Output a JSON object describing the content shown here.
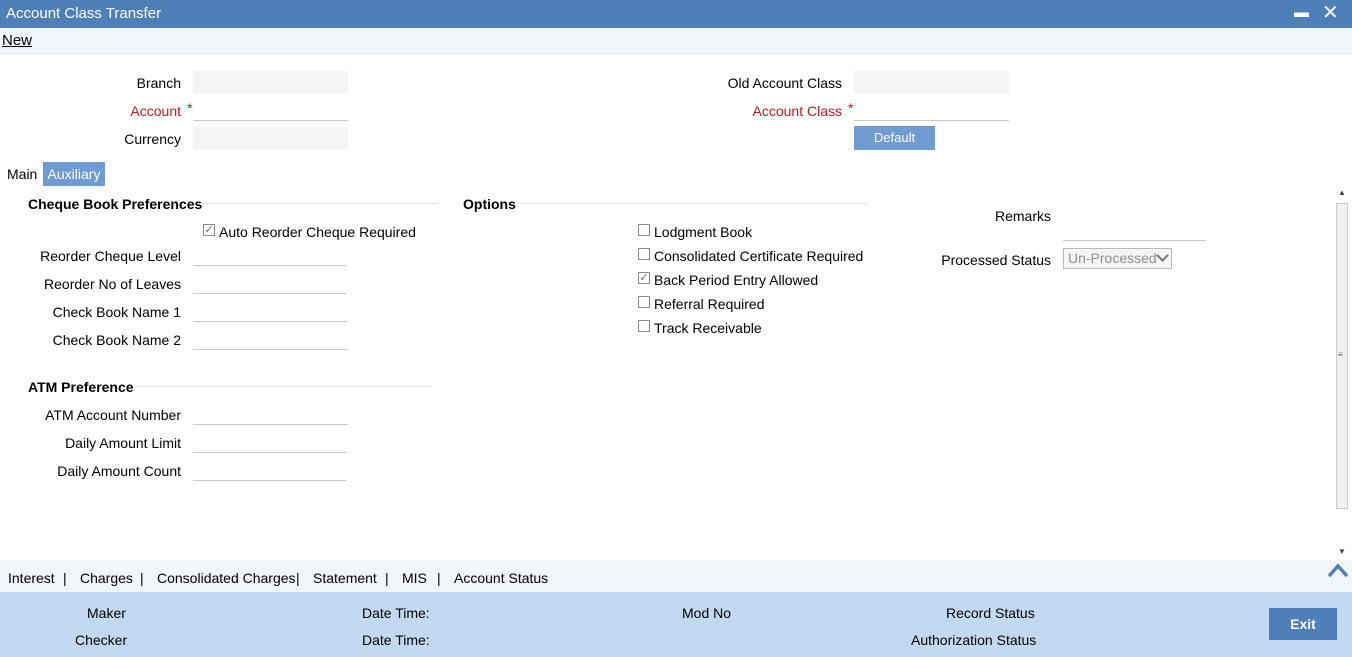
{
  "window": {
    "title": "Account Class Transfer",
    "minimize_glyph": "▬",
    "close_glyph": "✕"
  },
  "menu": {
    "new_label": "New"
  },
  "header": {
    "branch_label": "Branch",
    "account_label": "Account",
    "currency_label": "Currency",
    "old_account_class_label": "Old Account Class",
    "account_class_label": "Account Class",
    "required_mark": "*",
    "default_button": "Default"
  },
  "tabs": {
    "main": "Main",
    "auxiliary": "Auxiliary"
  },
  "cheque_book": {
    "title": "Cheque Book Preferences",
    "auto_reorder_label": "Auto Reorder Cheque Required",
    "auto_reorder_checked": true,
    "reorder_level_label": "Reorder Cheque Level",
    "reorder_leaves_label": "Reorder No of Leaves",
    "check_book_name1_label": "Check Book Name 1",
    "check_book_name2_label": "Check Book Name 2"
  },
  "atm": {
    "title": "ATM Preference",
    "account_number_label": "ATM Account Number",
    "daily_amount_limit_label": "Daily Amount Limit",
    "daily_amount_count_label": "Daily Amount Count"
  },
  "options": {
    "title": "Options",
    "items": [
      {
        "label": "Lodgment Book",
        "checked": false
      },
      {
        "label": "Consolidated Certificate Required",
        "checked": false
      },
      {
        "label": "Back Period Entry Allowed",
        "checked": true
      },
      {
        "label": "Referral Required",
        "checked": false
      },
      {
        "label": "Track Receivable",
        "checked": false
      }
    ]
  },
  "remarks": {
    "remarks_label": "Remarks",
    "processed_status_label": "Processed Status",
    "processed_status_value": "Un-Processed"
  },
  "bottom_links": [
    "Interest",
    "Charges",
    "Consolidated Charges",
    "Statement",
    "MIS",
    "Account Status"
  ],
  "link_separator": "|",
  "footer": {
    "maker_label": "Maker",
    "checker_label": "Checker",
    "date_time_label": "Date Time:",
    "mod_no_label": "Mod No",
    "record_status_label": "Record Status",
    "authorization_status_label": "Authorization Status",
    "exit_button": "Exit"
  },
  "colors": {
    "title_bar": "#4f7fb8",
    "button": "#6e9bd1",
    "footer": "#c3d9ef",
    "required": "#c4151c"
  }
}
